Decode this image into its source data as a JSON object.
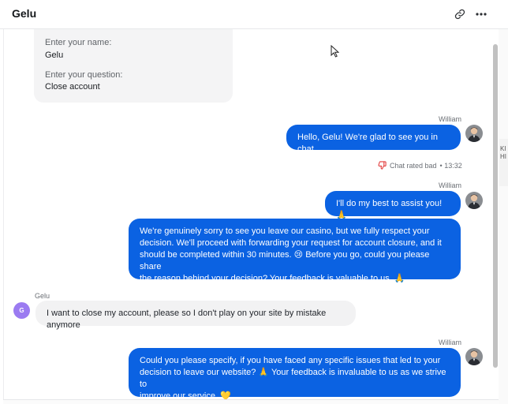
{
  "header": {
    "title": "Gelu",
    "link_icon": "link-icon",
    "more_icon": "more-horizontal-icon"
  },
  "form": {
    "name_label": "Enter your name:",
    "name_value": "Gelu",
    "question_label": "Enter your question:",
    "question_value": "Close account"
  },
  "messages": [
    {
      "sender": "William",
      "direction": "outgoing",
      "text": "Hello, Gelu! We're glad to see you in chat."
    },
    {
      "sender": "William",
      "direction": "outgoing",
      "text": "I'll do my best to assist you! 🙏"
    },
    {
      "sender": "William",
      "direction": "outgoing",
      "lines": [
        "We're genuinely sorry to see you leave our casino, but we fully respect your",
        "decision. We'll proceed with forwarding your request for account closure, and it",
        "should be completed within 30 minutes. 😢 Before you go, could you please share",
        "the reason behind your decision? Your feedback is valuable to us. 🙏"
      ]
    },
    {
      "sender": "Gelu",
      "direction": "incoming",
      "avatar_letter": "G",
      "text": "I want to close my account, please so I don't play on your site by mistake anymore"
    },
    {
      "sender": "William",
      "direction": "outgoing",
      "lines": [
        "Could you please specify, if you have faced any specific issues that led to your",
        "decision to leave our website? 🙏 Your feedback is invaluable to us as we strive to",
        "improve our service. 💛"
      ]
    }
  ],
  "rating": {
    "text": "Chat rated bad",
    "time": "• 13:32",
    "icon": "thumbs-down-icon"
  },
  "right_strip": [
    "KI",
    "HI"
  ],
  "colors": {
    "accent": "#0b62e2",
    "incoming_bg": "#f2f2f3",
    "avatar_purple": "#9b7bf1",
    "rating_red": "#e23c3c"
  }
}
